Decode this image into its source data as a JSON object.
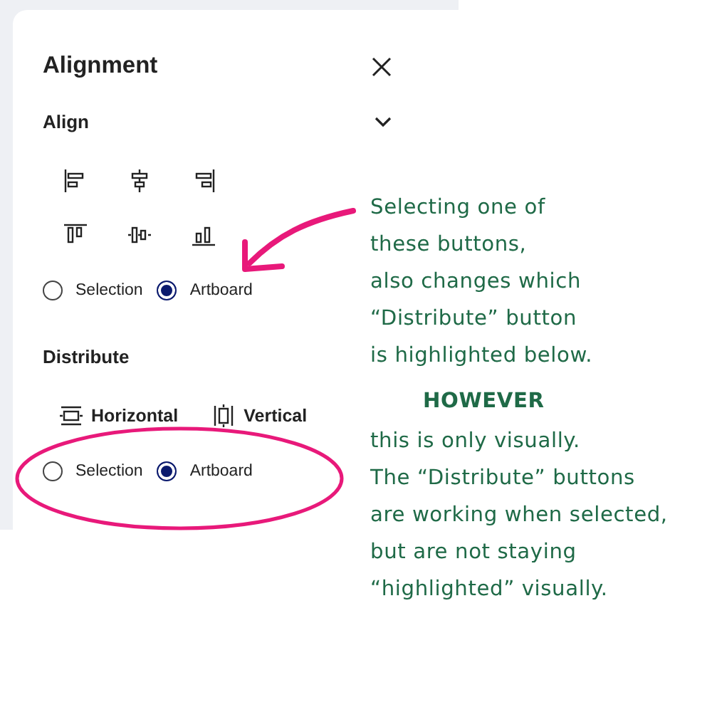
{
  "panel": {
    "title": "Alignment",
    "align": {
      "heading": "Align",
      "expanded": true,
      "radios": [
        {
          "label": "Selection",
          "selected": false
        },
        {
          "label": "Artboard",
          "selected": true
        }
      ]
    },
    "distribute": {
      "heading": "Distribute",
      "buttons": [
        {
          "label": "Horizontal",
          "kind": "horizontal"
        },
        {
          "label": "Vertical",
          "kind": "vertical"
        }
      ],
      "radios": [
        {
          "label": "Selection",
          "selected": false
        },
        {
          "label": "Artboard",
          "selected": true
        }
      ]
    }
  },
  "annotation": [
    {
      "kind": "text",
      "lines": [
        "Selecting one of",
        "these buttons,",
        "also changes which",
        "“Distribute” button",
        "is highlighted below."
      ]
    },
    {
      "kind": "emphasis",
      "lines": [
        "HOWEVER"
      ]
    },
    {
      "kind": "text",
      "lines": [
        "this is only visually.",
        "The “Distribute” buttons",
        "are working when selected,",
        "but are not staying",
        "“highlighted” visually."
      ]
    }
  ]
}
